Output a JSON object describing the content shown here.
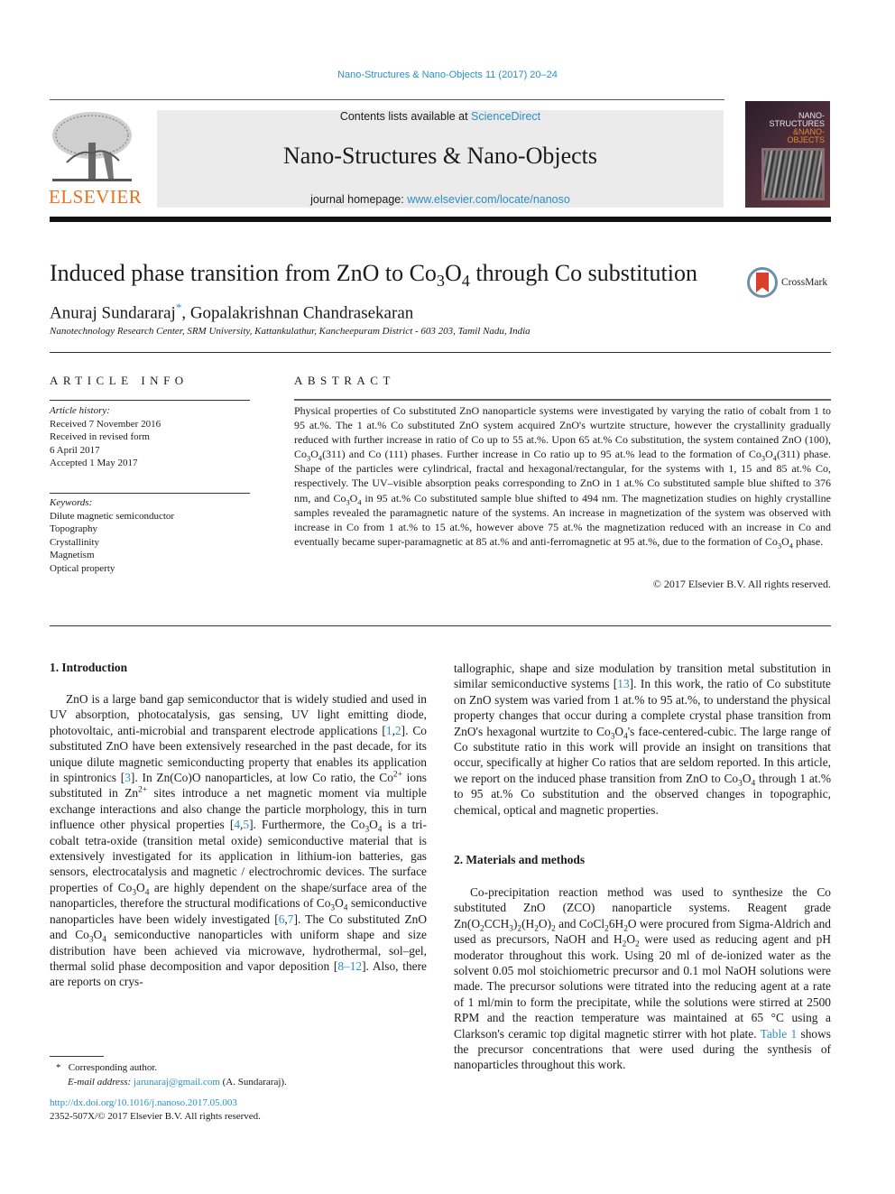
{
  "header": {
    "running_head": "Nano-Structures & Nano-Objects 11 (2017) 20–24",
    "publisher_logo_text": "ELSEVIER",
    "contents_prefix": "Contents lists available at ",
    "contents_link": "ScienceDirect",
    "journal_title": "Nano-Structures & Nano-Objects",
    "homepage_prefix": "journal homepage: ",
    "homepage_link": "www.elsevier.com/locate/nanoso",
    "cover": {
      "line1": "NANO-",
      "line2": "STRUCTURES",
      "line3": "&NANO-",
      "line4": "OBJECTS"
    }
  },
  "article": {
    "title_pre": "Induced phase transition from ZnO to Co",
    "title_sub1": "3",
    "title_mid": "O",
    "title_sub2": "4",
    "title_post": " through Co substitution",
    "crossmark_label": "CrossMark",
    "author1": "Anuraj Sundararaj",
    "author1_mark": "*",
    "author_sep": ", ",
    "author2": "Gopalakrishnan Chandrasekaran",
    "affiliation": "Nanotechnology Research Center, SRM University, Kattankulathur, Kancheepuram District - 603 203, Tamil Nadu, India"
  },
  "article_info": {
    "heading": "ARTICLE INFO",
    "history_label": "Article history:",
    "history": [
      "Received 7 November 2016",
      "Received in revised form",
      "6 April 2017",
      "Accepted 1 May 2017"
    ],
    "keywords_label": "Keywords:",
    "keywords": [
      "Dilute magnetic semiconductor",
      "Topography",
      "Crystallinity",
      "Magnetism",
      "Optical property"
    ]
  },
  "abstract": {
    "heading": "ABSTRACT",
    "text_1": "Physical properties of Co substituted ZnO nanoparticle systems were investigated by varying the ratio of cobalt from 1 to 95 at.%. The 1 at.% Co substituted ZnO system acquired ZnO's wurtzite structure, however the crystallinity gradually reduced with further increase in ratio of Co up to 55 at.%. Upon 65 at.% Co substitution, the system contained ZnO (100), Co",
    "text_2": "O",
    "text_3": "(311) and Co (111) phases. Further increase in Co ratio up to 95 at.% lead to the formation of Co",
    "text_4": "O",
    "text_5": "(311) phase. Shape of the particles were cylindrical, fractal and hexagonal/rectangular, for the systems with 1, 15 and 85 at.% Co, respectively. The UV–visible absorption peaks corresponding to ZnO in 1 at.% Co substituted sample blue shifted to 376 nm, and Co",
    "text_6": "O",
    "text_7": " in 95 at.% Co substituted sample blue shifted to 494 nm. The magnetization studies on highly crystalline samples revealed the paramagnetic nature of the systems. An increase in magnetization of the system was observed with increase in Co from 1 at.% to 15 at.%, however above 75 at.% the magnetization reduced with an increase in Co and eventually became super-paramagnetic at 85 at.% and anti-ferromagnetic at 95 at.%, due to the formation of Co",
    "text_8": "O",
    "text_9": " phase.",
    "sub3": "3",
    "sub4": "4",
    "copyright": "© 2017 Elsevier B.V. All rights reserved."
  },
  "intro": {
    "heading": "1.  Introduction",
    "p1_a": "ZnO is a large band gap semiconductor that is widely studied and used in UV absorption, photocatalysis, gas sensing, UV light emitting diode, photovoltaic, anti-microbial and transparent electrode applications [",
    "ref_1": "1",
    "ref_2": "2",
    "p1_b": "]. Co substituted ZnO have been extensively researched in the past decade, for its unique dilute magnetic semiconducting property that enables its application in spintronics [",
    "ref_3": "3",
    "p1_c": "]. In Zn(Co)O nanoparticles, at low Co ratio, the Co",
    "sup_2plus": "2+",
    "p1_d": " ions substituted in Zn",
    "p1_e": " sites introduce a net magnetic moment via multiple exchange interactions and also change the particle morphology, this in turn influence other physical properties [",
    "ref_4": "4",
    "ref_5": "5",
    "p1_f": "]. Furthermore, the Co",
    "p1_g": " is a tri-cobalt tetra-oxide (transition metal oxide) semiconductive material that is extensively investigated for its application in lithium-ion batteries, gas sensors, electrocatalysis and magnetic / electrochromic devices. The surface properties of Co",
    "p1_h": " are highly dependent on the shape/surface area of the nanoparticles, therefore the structural modifications of Co",
    "p1_i": " semiconductive nanoparticles have been widely investigated [",
    "ref_6": "6",
    "ref_7": "7",
    "p1_j": "]. The Co substituted ZnO and Co",
    "p1_k": " semiconductive nanoparticles with uniform shape and size distribution have been achieved via microwave, hydrothermal, sol–gel, thermal solid phase decomposition and vapor deposition [",
    "ref_8_12": "8–12",
    "p1_l": "]. Also, there are reports on crystallographic, shape and size modulation by transition metal substitution in similar semiconductive systems [",
    "ref_13": "13",
    "p1_m": "]. In this work, the ratio of Co substitute on ZnO system was varied from 1 at.% to 95 at.%, to understand the physical property changes that occur during a complete crystal phase transition from ZnO's hexagonal wurtzite to Co",
    "p1_n": "'s face-centered-cubic. The large range of Co substitute ratio in this work will provide an insight on transitions that occur, specifically at higher Co ratios that are seldom reported. In this article, we report on the induced phase transition from ZnO to Co",
    "p1_o": " through 1 at.% to 95 at.% Co substitution and the observed changes in topographic, chemical, optical and magnetic properties.",
    "o": "O",
    "s2": "2",
    "s3": "3",
    "s4": "4",
    "comma": ","
  },
  "methods": {
    "heading": "2.  Materials and methods",
    "p_a": "Co-precipitation reaction method was used to synthesize the Co substituted ZnO (ZCO) nanoparticle systems. Reagent grade Zn(O",
    "p_b": "CCH",
    "p_c": ")",
    "p_d": "(H",
    "p_e": "O)",
    "p_f": " and CoCl",
    "p_g": "6H",
    "p_h": "O were procured from Sigma-Aldrich and used as precursors, NaOH and H",
    "p_i": "O",
    "p_j": " were used as reducing agent and pH moderator throughout this work. Using 20 ml of de-ionized water as the solvent 0.05 mol stoichiometric precursor and 0.1 mol NaOH solutions were made. The precursor solutions were titrated into the reducing agent at a rate of 1 ml/min to form the precipitate, while the solutions were stirred at 2500 RPM and the reaction temperature was maintained at 65 °C using a Clarkson's ceramic top digital magnetic stirrer with hot plate. ",
    "table_link": "Table 1",
    "p_k": " shows the precursor concentrations that were used during the synthesis of nanoparticles throughout this work."
  },
  "footnote": {
    "mark": "*",
    "corresponding": "Corresponding author.",
    "email_label": "E-mail address: ",
    "email": "jarunaraj@gmail.com",
    "email_owner": " (A. Sundararaj).",
    "doi": "http://dx.doi.org/10.1016/j.nanoso.2017.05.003",
    "issn_copyright": "2352-507X/© 2017 Elsevier B.V. All rights reserved."
  }
}
